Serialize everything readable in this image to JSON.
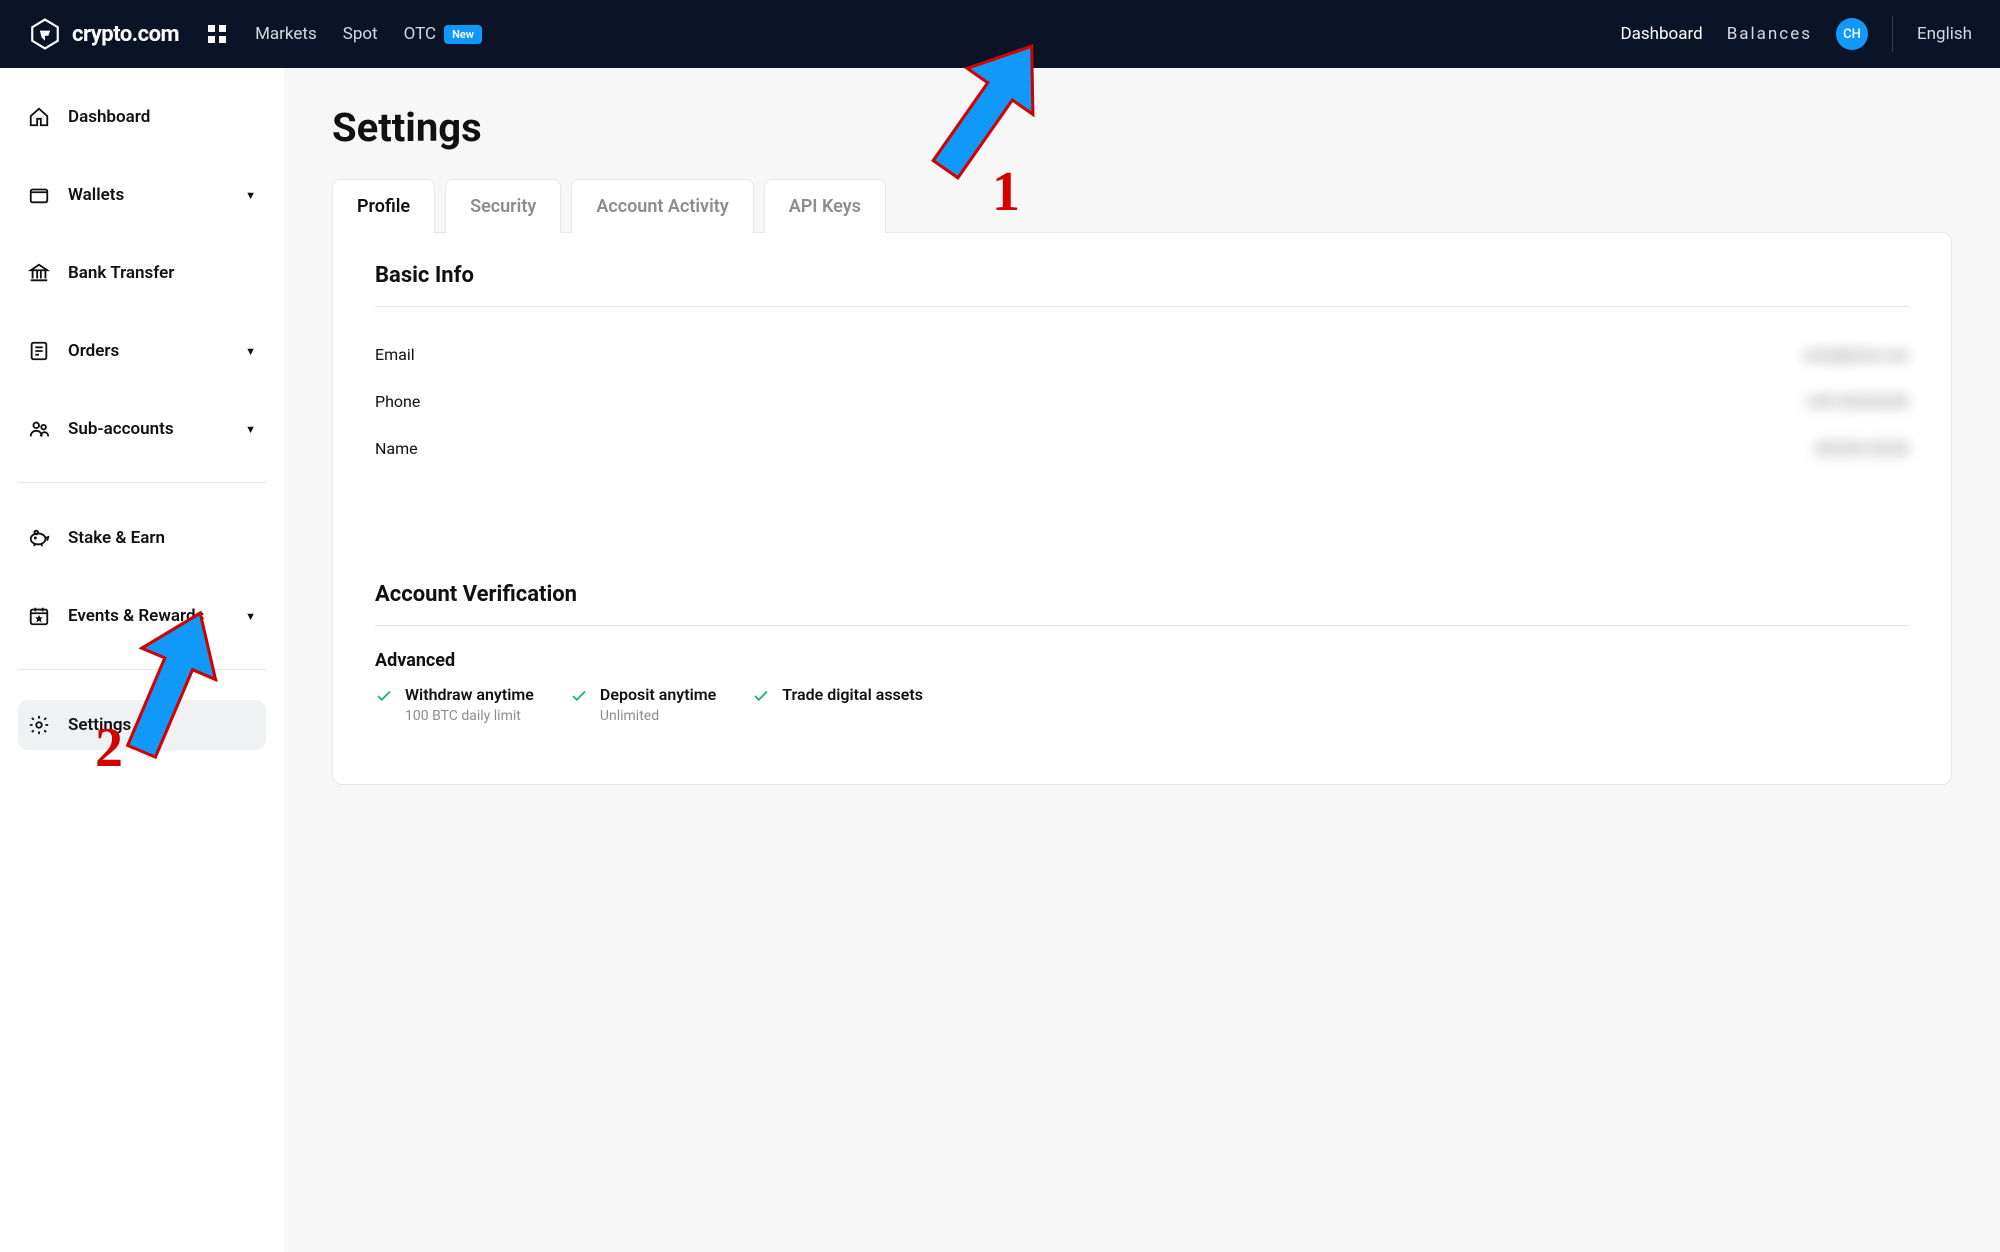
{
  "brand": {
    "name": "crypto.com"
  },
  "topnav": {
    "left": [
      {
        "label": "Markets"
      },
      {
        "label": "Spot"
      },
      {
        "label": "OTC",
        "badge": "New"
      }
    ],
    "right": [
      {
        "label": "Dashboard"
      },
      {
        "label": "Balances"
      }
    ],
    "avatar": "CH",
    "language": "English"
  },
  "sidebar": {
    "items": [
      {
        "label": "Dashboard",
        "icon": "home",
        "chevron": false
      },
      {
        "label": "Wallets",
        "icon": "wallet",
        "chevron": true
      },
      {
        "label": "Bank Transfer",
        "icon": "bank",
        "chevron": false
      },
      {
        "label": "Orders",
        "icon": "orders",
        "chevron": true
      },
      {
        "label": "Sub-accounts",
        "icon": "subaccounts",
        "chevron": true
      },
      {
        "label": "Stake & Earn",
        "icon": "piggy",
        "chevron": false
      },
      {
        "label": "Events & Rewards",
        "icon": "calendar",
        "chevron": true
      },
      {
        "label": "Settings",
        "icon": "gear",
        "chevron": false,
        "active": true
      }
    ]
  },
  "page": {
    "title": "Settings"
  },
  "tabs": [
    {
      "label": "Profile",
      "active": true
    },
    {
      "label": "Security"
    },
    {
      "label": "Account Activity"
    },
    {
      "label": "API Keys"
    }
  ],
  "basic_info": {
    "title": "Basic Info",
    "rows": [
      {
        "label": "Email",
        "value": "xxxx@xxxx.xxx"
      },
      {
        "label": "Phone",
        "value": "+XX XXXXXXX"
      },
      {
        "label": "Name",
        "value": "XXXXX XXXX"
      }
    ]
  },
  "verification": {
    "title": "Account Verification",
    "level": "Advanced",
    "features": [
      {
        "title": "Withdraw anytime",
        "sub": "100 BTC daily limit"
      },
      {
        "title": "Deposit anytime",
        "sub": "Unlimited"
      },
      {
        "title": "Trade digital assets",
        "sub": ""
      }
    ]
  },
  "annotations": {
    "arrow1_num": "1",
    "arrow2_num": "2"
  }
}
